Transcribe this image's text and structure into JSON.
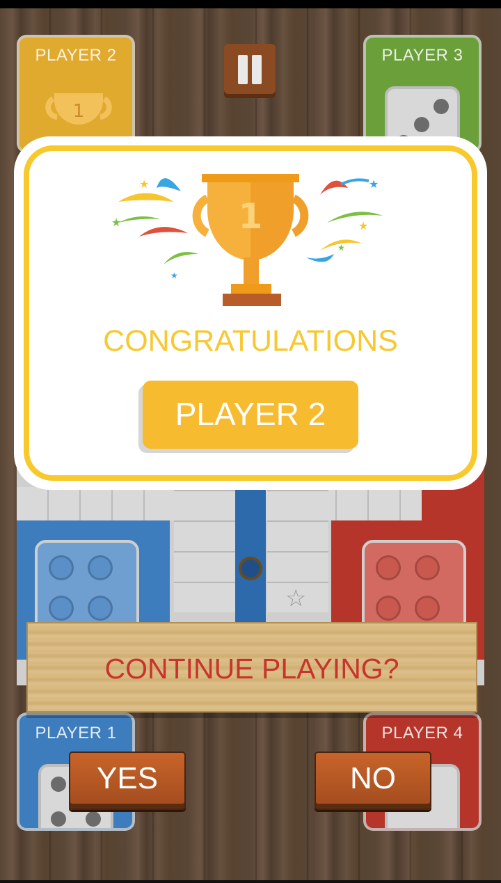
{
  "players": {
    "p1": "PLAYER 1",
    "p2": "PLAYER 2",
    "p3": "PLAYER 3",
    "p4": "PLAYER 4"
  },
  "win_modal": {
    "trophy_number": "1",
    "title": "CONGRATULATIONS",
    "winner": "PLAYER 2"
  },
  "continue": {
    "question": "CONTINUE PLAYING?",
    "yes": "YES",
    "no": "NO"
  },
  "colors": {
    "yellow": "#f7c92d",
    "green": "#6a9f3a",
    "blue": "#3d7dbd",
    "red": "#b6352b",
    "question_text": "#c8342b"
  },
  "icons": [
    "pause-icon",
    "trophy-icon",
    "dice-icon",
    "star-icon",
    "token-icon"
  ]
}
